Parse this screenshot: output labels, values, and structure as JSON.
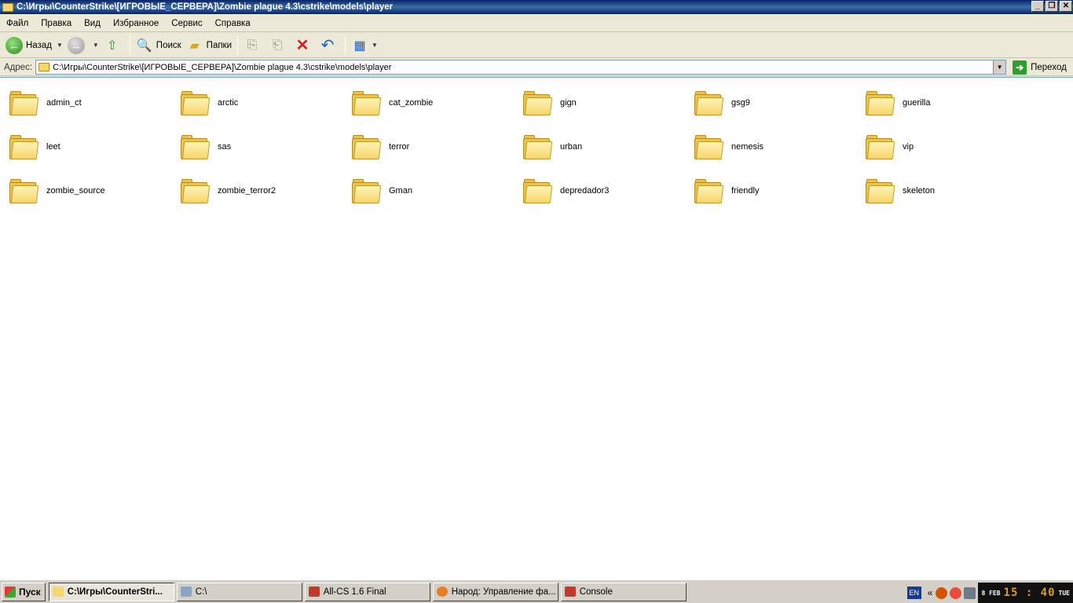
{
  "window": {
    "title": "C:\\Игры\\CounterStrike\\[ИГРОВЫЕ_СЕРВЕРА]\\Zombie plague 4.3\\cstrike\\models\\player",
    "buttons": {
      "minimize": "_",
      "maximize": "❐",
      "close": "✕"
    }
  },
  "menu": {
    "items": [
      "Файл",
      "Правка",
      "Вид",
      "Избранное",
      "Сервис",
      "Справка"
    ]
  },
  "toolbar": {
    "back": "Назад",
    "search": "Поиск",
    "folders": "Папки"
  },
  "address": {
    "label": "Адрес:",
    "value": "C:\\Игры\\CounterStrike\\[ИГРОВЫЕ_СЕРВЕРА]\\Zombie plague 4.3\\cstrike\\models\\player",
    "go": "Переход"
  },
  "folders": [
    "admin_ct",
    "arctic",
    "cat_zombie",
    "gign",
    "gsg9",
    "guerilla",
    "leet",
    "sas",
    "terror",
    "urban",
    "nemesis",
    "vip",
    "zombie_source",
    "zombie_terror2",
    "Gman",
    "depredador3",
    "friendly",
    "skeleton"
  ],
  "taskbar": {
    "start": "Пуск",
    "tasks": [
      {
        "label": "C:\\Игры\\CounterStri...",
        "color": "#f5d76e"
      },
      {
        "label": "C:\\",
        "color": "#8aa4c8"
      },
      {
        "label": "All-CS 1.6 Final",
        "color": "#c0392b"
      },
      {
        "label": "Народ: Управление фа...",
        "color": "#e67e22"
      },
      {
        "label": "Console",
        "color": "#c0392b"
      }
    ],
    "lang": "EN",
    "tray_arrow": "«",
    "clock": {
      "day_small": "8 FEB",
      "time": "15 : 40",
      "weekday": "TUE"
    }
  }
}
